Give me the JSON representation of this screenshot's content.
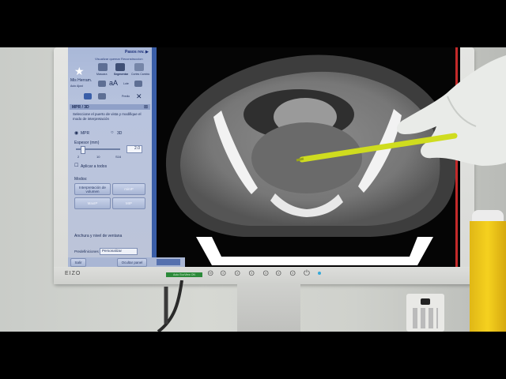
{
  "panel": {
    "top_link": "Pasos rev. ▶",
    "subtitle": "Visualizar quemar Reconstruccion",
    "tools_label": "Mis Herram.",
    "tool_labels": [
      "Mascara",
      "Segmentar",
      "Cortes Cambio",
      "Lote",
      "Auto Ajust",
      "Predio"
    ],
    "section_header": "MPR / 3D",
    "instructions": "Seleccione el puerto de vista y modifique el modo de interpretación",
    "radio_mpr": "MPR",
    "radio_3d": "3D",
    "thickness_label": "Espesor (mm)",
    "thickness_value": "2.0",
    "scale_ticks": [
      "2",
      "10",
      "S16"
    ],
    "apply_all": "Aplicar a todos",
    "modes_label": "Modos:",
    "mode_buttons": [
      "Interpretación de volumen",
      "minIP",
      "MaxIP",
      "MIP"
    ],
    "width_level_label": "Anchura y nivel de ventana",
    "presets_label": "Predefiniciones",
    "presets_value": "Personalizar",
    "exit_button": "Salir",
    "hide_panel_button": "Ocultar panel"
  },
  "monitor": {
    "brand": "EIZO",
    "badge": "Auto EcoView ON"
  },
  "colors": {
    "panel_bg": "#b3bfdb",
    "accent_blue": "#3a5ea8",
    "screen_edge_red": "#c52a2a",
    "pen_yellow": "#d7e32a",
    "jar_yellow": "#f5d11f"
  }
}
